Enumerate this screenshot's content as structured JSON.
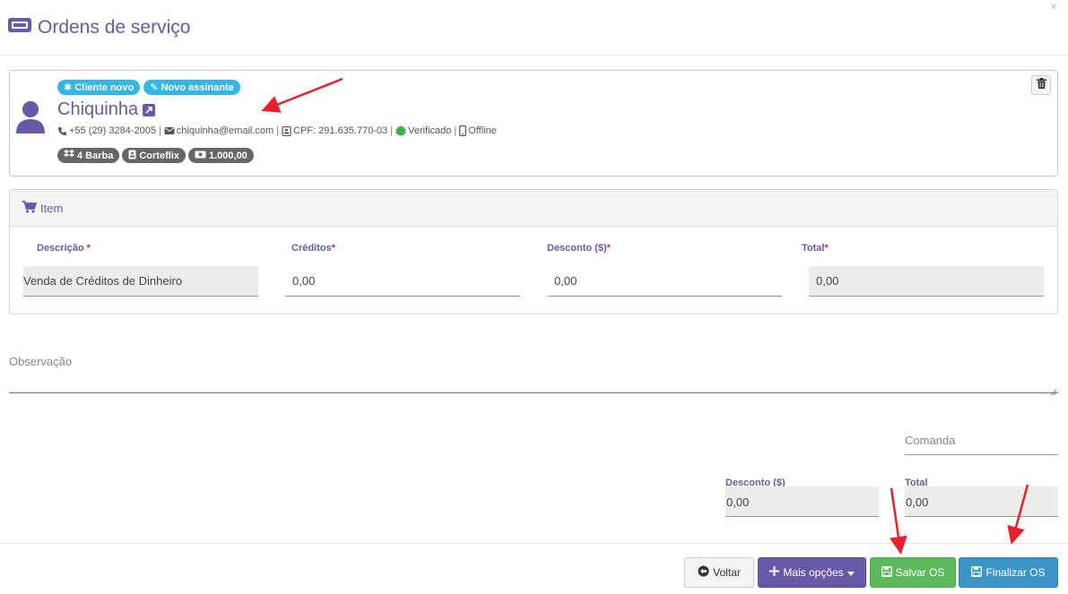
{
  "header": {
    "title": "Ordens de serviço",
    "close": "×"
  },
  "client": {
    "badges": [
      "Cliente novo",
      "Novo assinante"
    ],
    "name": "Chiquinha",
    "phone": "+55 (29) 3284-2005",
    "email": "chiquinha@email.com",
    "cpf": "CPF: 291.635.770-03",
    "verified": "Verificado",
    "device": "Offline",
    "tags": [
      "4 Barba",
      "Corteflix",
      "1.000,00"
    ]
  },
  "item": {
    "title": "Item",
    "columns": {
      "descricao": "Descrição",
      "creditos": "Créditos",
      "desconto": "Desconto ($)",
      "total": "Total"
    },
    "values": {
      "descricao": "Venda de Créditos de Dinheiro",
      "creditos": "0,00",
      "desconto": "0,00",
      "total": "0,00"
    }
  },
  "observacao": {
    "label": "Observação"
  },
  "comanda": {
    "placeholder": "Comanda"
  },
  "totals": {
    "desconto_label": "Desconto ($)",
    "desconto_value": "0,00",
    "total_label": "Total",
    "total_value": "0,00"
  },
  "footer": {
    "voltar": "Voltar",
    "mais_opcoes": "Mais opções",
    "salvar": "Salvar OS",
    "finalizar": "Finalizar OS"
  },
  "colors": {
    "accent": "#6a58a8",
    "badge_blue": "#36b6e8",
    "success": "#5cb85c",
    "info": "#3d94c8",
    "verified_green": "#3fae49",
    "annotation_red": "#e8202e"
  }
}
